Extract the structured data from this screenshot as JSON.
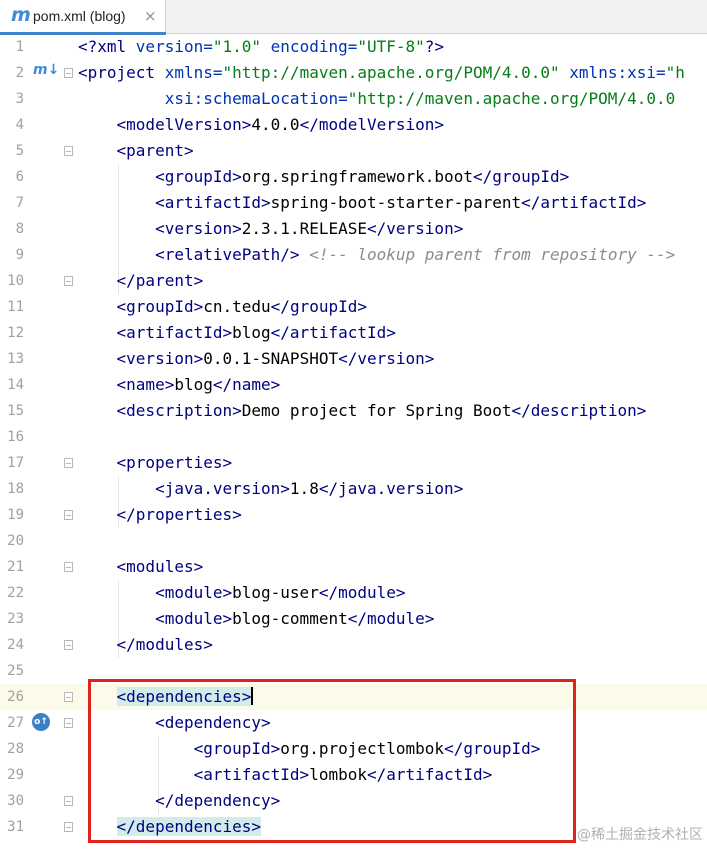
{
  "tab": {
    "icon": "maven-icon",
    "title": "pom.xml (blog)",
    "close": "×"
  },
  "watermark": "@稀土掘金技术社区",
  "lines": [
    {
      "n": "1",
      "code": [
        [
          "<?",
          "t"
        ],
        [
          "xml ",
          "t"
        ],
        [
          "version=",
          "ab"
        ],
        [
          "\"1.0\"",
          "av"
        ],
        [
          " encoding=",
          "ab"
        ],
        [
          "\"UTF-8\"",
          "av"
        ],
        [
          "?>",
          "t"
        ]
      ]
    },
    {
      "n": "2",
      "code": [
        [
          "<project ",
          "t"
        ],
        [
          "xmlns=",
          "ab"
        ],
        [
          "\"http://maven.apache.org/POM/4.0.0\"",
          "av"
        ],
        [
          " xmlns:xsi=",
          "ab"
        ],
        [
          "\"h",
          "av"
        ]
      ],
      "fold": "start",
      "gutter": "maven-icon"
    },
    {
      "n": "3",
      "code": [
        [
          "         xsi:schemaLocation=",
          "ab"
        ],
        [
          "\"http://maven.apache.org/POM/4.0.0",
          "av"
        ]
      ]
    },
    {
      "n": "4",
      "code": [
        [
          "    <modelVersion>",
          "t"
        ],
        [
          "4.0.0",
          ""
        ],
        [
          "</modelVersion>",
          "t"
        ]
      ]
    },
    {
      "n": "5",
      "code": [
        [
          "    <parent>",
          "t"
        ]
      ],
      "fold": "start"
    },
    {
      "n": "6",
      "code": [
        [
          "        <groupId>",
          "t"
        ],
        [
          "org.springframework.boot",
          ""
        ],
        [
          "</groupId>",
          "t"
        ]
      ]
    },
    {
      "n": "7",
      "code": [
        [
          "        <artifactId>",
          "t"
        ],
        [
          "spring-boot-starter-parent",
          ""
        ],
        [
          "</artifactId>",
          "t"
        ]
      ]
    },
    {
      "n": "8",
      "code": [
        [
          "        <version>",
          "t"
        ],
        [
          "2.3.1.RELEASE",
          ""
        ],
        [
          "</version>",
          "t"
        ]
      ]
    },
    {
      "n": "9",
      "code": [
        [
          "        <relativePath/>",
          "t"
        ],
        [
          " ",
          ""
        ],
        [
          "<!-- lookup parent from repository -->",
          "cm"
        ]
      ]
    },
    {
      "n": "10",
      "code": [
        [
          "    </parent>",
          "t"
        ]
      ],
      "fold": "end"
    },
    {
      "n": "11",
      "code": [
        [
          "    <groupId>",
          "t"
        ],
        [
          "cn.tedu",
          ""
        ],
        [
          "</groupId>",
          "t"
        ]
      ]
    },
    {
      "n": "12",
      "code": [
        [
          "    <artifactId>",
          "t"
        ],
        [
          "blog",
          ""
        ],
        [
          "</artifactId>",
          "t"
        ]
      ]
    },
    {
      "n": "13",
      "code": [
        [
          "    <version>",
          "t"
        ],
        [
          "0.0.1-SNAPSHOT",
          ""
        ],
        [
          "</version>",
          "t"
        ]
      ]
    },
    {
      "n": "14",
      "code": [
        [
          "    <name>",
          "t"
        ],
        [
          "blog",
          ""
        ],
        [
          "</name>",
          "t"
        ]
      ]
    },
    {
      "n": "15",
      "code": [
        [
          "    <description>",
          "t"
        ],
        [
          "Demo project for Spring Boot",
          ""
        ],
        [
          "</description>",
          "t"
        ]
      ]
    },
    {
      "n": "16",
      "code": []
    },
    {
      "n": "17",
      "code": [
        [
          "    <properties>",
          "t"
        ]
      ],
      "fold": "start"
    },
    {
      "n": "18",
      "code": [
        [
          "        <java.version>",
          "t"
        ],
        [
          "1.8",
          ""
        ],
        [
          "</java.version>",
          "t"
        ]
      ]
    },
    {
      "n": "19",
      "code": [
        [
          "    </properties>",
          "t"
        ]
      ],
      "fold": "end"
    },
    {
      "n": "20",
      "code": []
    },
    {
      "n": "21",
      "code": [
        [
          "    <modules>",
          "t"
        ]
      ],
      "fold": "start"
    },
    {
      "n": "22",
      "code": [
        [
          "        <module>",
          "t"
        ],
        [
          "blog-user",
          ""
        ],
        [
          "</module>",
          "t"
        ]
      ]
    },
    {
      "n": "23",
      "code": [
        [
          "        <module>",
          "t"
        ],
        [
          "blog-comment",
          ""
        ],
        [
          "</module>",
          "t"
        ]
      ]
    },
    {
      "n": "24",
      "code": [
        [
          "    </modules>",
          "t"
        ]
      ],
      "fold": "end"
    },
    {
      "n": "25",
      "code": []
    },
    {
      "n": "26",
      "code": [
        [
          "    ",
          ""
        ],
        [
          "<dependencies>",
          "t hl"
        ]
      ],
      "fold": "start",
      "current": true,
      "caret": true
    },
    {
      "n": "27",
      "code": [
        [
          "        <dependency>",
          "t"
        ]
      ],
      "fold": "start",
      "gutter": "override-icon"
    },
    {
      "n": "28",
      "code": [
        [
          "            <groupId>",
          "t"
        ],
        [
          "org.projectlombok",
          ""
        ],
        [
          "</groupId>",
          "t"
        ]
      ]
    },
    {
      "n": "29",
      "code": [
        [
          "            <artifactId>",
          "t"
        ],
        [
          "lombok",
          ""
        ],
        [
          "</artifactId>",
          "t"
        ]
      ]
    },
    {
      "n": "30",
      "code": [
        [
          "        </dependency>",
          "t"
        ]
      ],
      "fold": "end"
    },
    {
      "n": "31",
      "code": [
        [
          "    ",
          ""
        ],
        [
          "</dependencies>",
          "t hl"
        ]
      ],
      "fold": "end"
    }
  ]
}
